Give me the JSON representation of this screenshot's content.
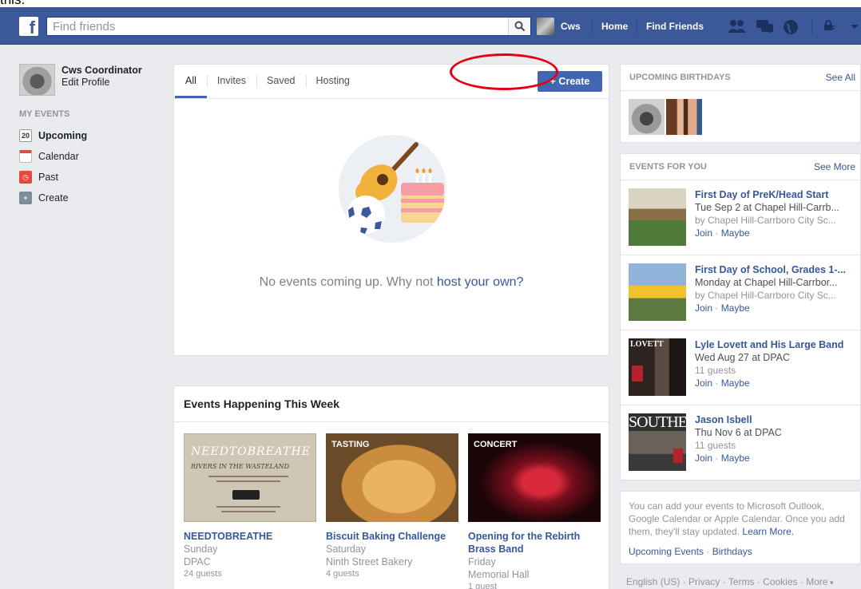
{
  "top_strip_text": "this.",
  "header": {
    "search_placeholder": "Find friends",
    "user_name": "Cws",
    "home": "Home",
    "find_friends": "Find Friends"
  },
  "left_nav": {
    "profile_name": "Cws Coordinator",
    "edit_profile": "Edit Profile",
    "section_title": "MY EVENTS",
    "items": [
      {
        "label": "Upcoming",
        "icon": "calendar-date-icon",
        "icon_text": "20"
      },
      {
        "label": "Calendar",
        "icon": "calendar-icon"
      },
      {
        "label": "Past",
        "icon": "clock-icon"
      },
      {
        "label": "Create",
        "icon": "plus-icon"
      }
    ]
  },
  "main": {
    "tabs": [
      {
        "label": "All"
      },
      {
        "label": "Invites"
      },
      {
        "label": "Saved"
      },
      {
        "label": "Hosting"
      }
    ],
    "create_button": "+ Create",
    "empty_text": "No events coming up. Why not ",
    "empty_link": "host your own?"
  },
  "week": {
    "title": "Events Happening This Week",
    "items": [
      {
        "name": "NEEDTOBREATHE",
        "day": "Sunday",
        "place": "DPAC",
        "guests": "24 guests",
        "tag": "",
        "poster_title": "NEEDTOBREATHE",
        "poster_sub": "RIVERS IN THE WASTELAND"
      },
      {
        "name": "Biscuit Baking Challenge",
        "day": "Saturday",
        "place": "Ninth Street Bakery",
        "guests": "4 guests",
        "tag": "TASTING"
      },
      {
        "name": "Opening for the Rebirth Brass Band",
        "day": "Friday",
        "place": "Memorial Hall",
        "guests": "1 guest",
        "tag": "CONCERT"
      }
    ]
  },
  "birthdays": {
    "title": "UPCOMING BIRTHDAYS",
    "see_all": "See All"
  },
  "events_for_you": {
    "title": "EVENTS FOR YOU",
    "see_more": "See More",
    "join": "Join",
    "maybe": "Maybe",
    "items": [
      {
        "name": "First Day of PreK/Head Start",
        "when": "Tue Sep 2 at Chapel Hill-Carrb...",
        "by": "by Chapel Hill-Carrboro City Sc..."
      },
      {
        "name": "First Day of School, Grades 1-...",
        "when": "Monday at Chapel Hill-Carrbor...",
        "by": "by Chapel Hill-Carrboro City Sc..."
      },
      {
        "name": "Lyle Lovett and His Large Band",
        "when": "Wed Aug 27 at DPAC",
        "by": "11 guests",
        "poster": "LOVETT"
      },
      {
        "name": "Jason Isbell",
        "when": "Thu Nov 6 at DPAC",
        "by": "11 guests",
        "poster": "SOUTHEASTERN"
      }
    ]
  },
  "calendar_note": {
    "text": "You can add your events to Microsoft Outlook, Google Calendar or Apple Calendar. Once you add them, they'll stay updated.",
    "learn_more": "Learn More.",
    "upcoming_events": "Upcoming Events",
    "birthdays": "Birthdays"
  },
  "footer": {
    "language": "English (US)",
    "privacy": "Privacy",
    "terms": "Terms",
    "cookies": "Cookies",
    "more": "More"
  }
}
